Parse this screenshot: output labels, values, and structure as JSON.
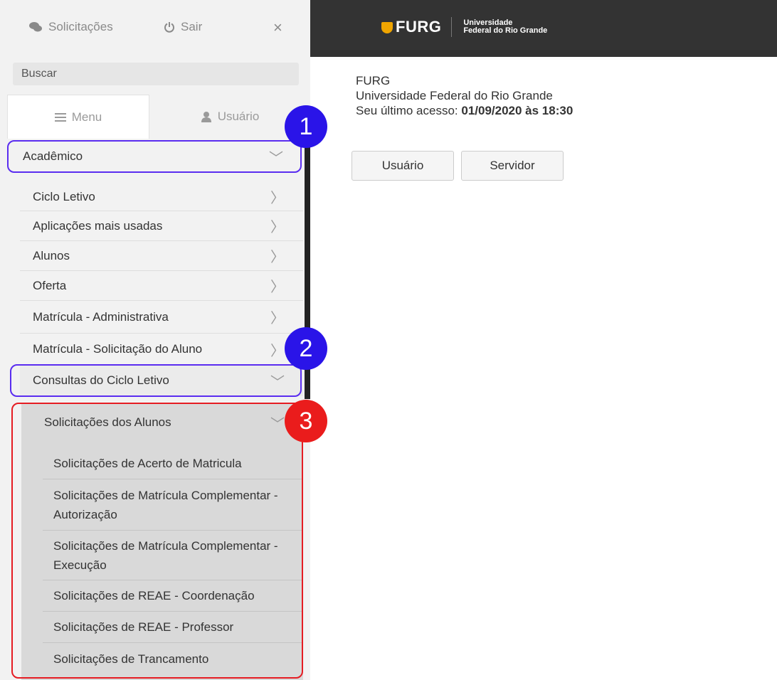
{
  "topbar": {
    "requests_label": "Solicitações",
    "logout_label": "Sair",
    "close_symbol": "×"
  },
  "search": {
    "value": "Buscar"
  },
  "tabs": {
    "menu_label": "Menu",
    "user_label": "Usuário"
  },
  "menu": {
    "academic": {
      "label": "Acadêmico"
    },
    "items": [
      {
        "label": "Ciclo Letivo"
      },
      {
        "label": "Aplicações mais usadas"
      },
      {
        "label": "Alunos"
      },
      {
        "label": "Oferta"
      },
      {
        "label": "Matrícula - Administrativa"
      },
      {
        "label": "Matrícula - Solicitação do Aluno"
      }
    ],
    "consultas": {
      "label": "Consultas do Ciclo Letivo"
    },
    "solicitacoes": {
      "label": "Solicitações dos Alunos",
      "items": [
        {
          "label": "Solicitações de Acerto de Matricula"
        },
        {
          "label": "Solicitações de Matrícula Complementar - Autorização"
        },
        {
          "label": "Solicitações de Matrícula Complementar - Execução"
        },
        {
          "label": "Solicitações de REAE - Coordenação"
        },
        {
          "label": "Solicitações de REAE - Professor"
        },
        {
          "label": "Solicitações de Trancamento"
        }
      ]
    }
  },
  "annotations": {
    "badge1": "1",
    "badge2": "2",
    "badge3": "3"
  },
  "header": {
    "logo_text": "FURG",
    "logo_sub_line1": "Universidade",
    "logo_sub_line2": "Federal do Rio Grande"
  },
  "main": {
    "title": "FURG",
    "subtitle": "Universidade Federal do Rio Grande",
    "last_access_prefix": "Seu último acesso: ",
    "last_access_value": "01/09/2020 às 18:30",
    "buttons": {
      "user": "Usuário",
      "server": "Servidor"
    }
  },
  "colors": {
    "header_bg": "#333333",
    "highlight_blue": "#5a2df0",
    "badge_blue": "#2a14e8",
    "badge_red": "#ea1c1c",
    "logo_accent": "#f0a500"
  },
  "icons": [
    "chat-icon",
    "power-icon",
    "close-icon",
    "hamburger-icon",
    "user-icon",
    "chevron-right-icon",
    "chevron-down-icon"
  ]
}
